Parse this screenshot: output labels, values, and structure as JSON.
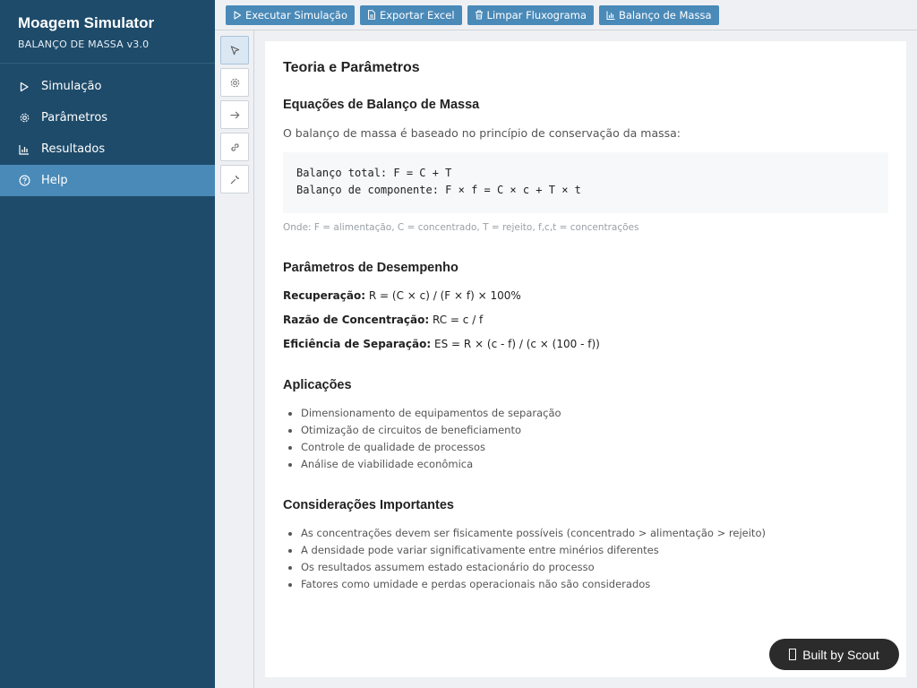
{
  "sidebar": {
    "title": "Moagem Simulator",
    "subtitle": "BALANÇO DE MASSA v3.0",
    "items": [
      {
        "label": "Simulação",
        "icon": "play-icon"
      },
      {
        "label": "Parâmetros",
        "icon": "gear-icon"
      },
      {
        "label": "Resultados",
        "icon": "bar-chart-icon"
      },
      {
        "label": "Help",
        "icon": "help-circle-icon",
        "active": true
      }
    ]
  },
  "toolbar": {
    "run_label": "Executar Simulação",
    "export_label": "Exportar Excel",
    "clear_label": "Limpar Fluxograma",
    "balance_label": "Balanço de Massa"
  },
  "tools": [
    "pointer-icon",
    "gear-icon",
    "arrow-right-icon",
    "link-icon",
    "wrench-icon"
  ],
  "content": {
    "title": "Teoria e Parâmetros",
    "section1": {
      "heading": "Equações de Balanço de Massa",
      "intro": "O balanço de massa é baseado no princípio de conservação da massa:",
      "code_line1": "Balanço total: F = C + T",
      "code_line2": "Balanço de componente: F × f = C × c + T × t",
      "note": "Onde: F = alimentação, C = concentrado, T = rejeito, f,c,t = concentrações"
    },
    "section2": {
      "heading": "Parâmetros de Desempenho",
      "metrics": [
        {
          "label": "Recuperação:",
          "value": "R = (C × c) / (F × f) × 100%"
        },
        {
          "label": "Razão de Concentração:",
          "value": "RC = c / f"
        },
        {
          "label": "Eficiência de Separação:",
          "value": "ES = R × (c - f) / (c × (100 - f))"
        }
      ]
    },
    "section3": {
      "heading": "Aplicações",
      "items": [
        "Dimensionamento de equipamentos de separação",
        "Otimização de circuitos de beneficiamento",
        "Controle de qualidade de processos",
        "Análise de viabilidade econômica"
      ]
    },
    "section4": {
      "heading": "Considerações Importantes",
      "items": [
        "As concentrações devem ser fisicamente possíveis (concentrado > alimentação > rejeito)",
        "A densidade pode variar significativamente entre minérios diferentes",
        "Os resultados assumem estado estacionário do processo",
        "Fatores como umidade e perdas operacionais não são considerados"
      ]
    }
  },
  "badge": {
    "label": "Built by Scout"
  },
  "colors": {
    "sidebar": "#1e4b6a",
    "accent": "#4a8ab8"
  }
}
